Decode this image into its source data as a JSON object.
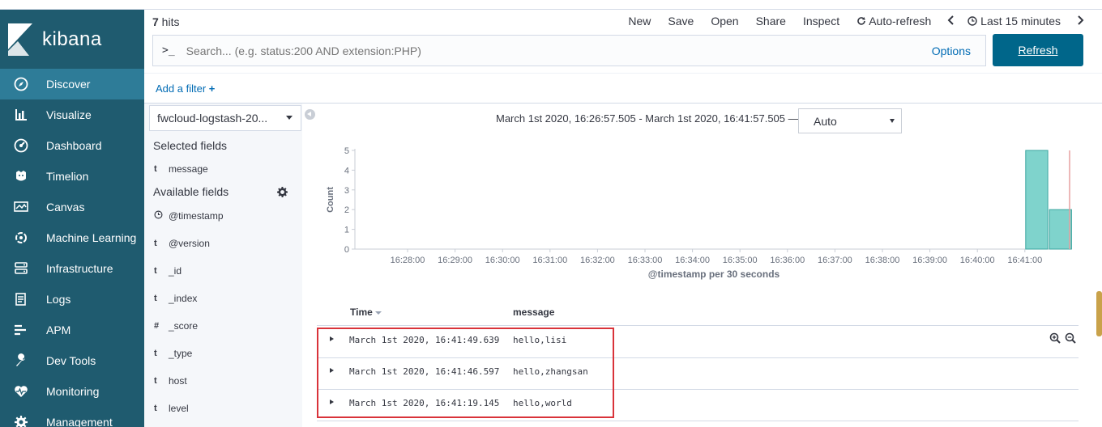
{
  "app": {
    "name": "kibana"
  },
  "colors": {
    "sidebar_bg": "#1f5b6f",
    "sidebar_active": "#2e7c98",
    "link": "#006bb4",
    "primary_button": "#00668a",
    "bar": "#7fd3cc",
    "bar_stroke": "#3aa69f",
    "now_line": "#e7a0a0",
    "highlight": "#d9333a"
  },
  "sidebar": {
    "items": [
      {
        "label": "Discover",
        "icon": "compass-icon",
        "active": true
      },
      {
        "label": "Visualize",
        "icon": "bar-chart-icon"
      },
      {
        "label": "Dashboard",
        "icon": "gauge-icon"
      },
      {
        "label": "Timelion",
        "icon": "timelion-icon"
      },
      {
        "label": "Canvas",
        "icon": "canvas-icon"
      },
      {
        "label": "Machine Learning",
        "icon": "ml-icon"
      },
      {
        "label": "Infrastructure",
        "icon": "server-icon"
      },
      {
        "label": "Logs",
        "icon": "logs-icon"
      },
      {
        "label": "APM",
        "icon": "apm-icon"
      },
      {
        "label": "Dev Tools",
        "icon": "wrench-icon"
      },
      {
        "label": "Monitoring",
        "icon": "heartbeat-icon"
      },
      {
        "label": "Management",
        "icon": "gear-icon"
      }
    ]
  },
  "topbar": {
    "hits_count": "7",
    "hits_label": " hits",
    "menu": [
      "New",
      "Save",
      "Open",
      "Share",
      "Inspect"
    ],
    "auto_refresh": "Auto-refresh",
    "time_label": "Last 15 minutes"
  },
  "query": {
    "prompt": ">_",
    "placeholder": "Search... (e.g. status:200 AND extension:PHP)",
    "options": "Options",
    "refresh": "Refresh"
  },
  "filters": {
    "add_filter": "Add a filter"
  },
  "fields": {
    "index_pattern": "fwcloud-logstash-20...",
    "selected_title": "Selected fields",
    "selected": [
      {
        "type": "t",
        "name": "message"
      }
    ],
    "available_title": "Available fields",
    "available": [
      {
        "type": "clock",
        "name": "@timestamp"
      },
      {
        "type": "t",
        "name": "@version"
      },
      {
        "type": "t",
        "name": "_id"
      },
      {
        "type": "t",
        "name": "_index"
      },
      {
        "type": "#",
        "name": "_score"
      },
      {
        "type": "t",
        "name": "_type"
      },
      {
        "type": "t",
        "name": "host"
      },
      {
        "type": "t",
        "name": "level"
      }
    ]
  },
  "histogram": {
    "date_range": "March 1st 2020, 16:26:57.505 - March 1st 2020, 16:41:57.505 —",
    "interval": "Auto"
  },
  "chart_data": {
    "type": "bar",
    "xlabel": "@timestamp per 30 seconds",
    "ylabel": "Count",
    "ylim": [
      0,
      5
    ],
    "yticks": [
      0,
      1,
      2,
      3,
      4,
      5
    ],
    "xticks": [
      "16:28:00",
      "16:29:00",
      "16:30:00",
      "16:31:00",
      "16:32:00",
      "16:33:00",
      "16:34:00",
      "16:35:00",
      "16:36:00",
      "16:37:00",
      "16:38:00",
      "16:39:00",
      "16:40:00",
      "16:41:00"
    ],
    "bars": [
      {
        "start": "16:41:00",
        "end": "16:41:30",
        "value": 5
      },
      {
        "start": "16:41:30",
        "end": "16:42:00",
        "value": 2
      }
    ],
    "grid": false
  },
  "table": {
    "columns": [
      "Time",
      "message"
    ],
    "rows": [
      {
        "time": "March 1st 2020, 16:41:49.639",
        "message": "hello,lisi"
      },
      {
        "time": "March 1st 2020, 16:41:46.597",
        "message": "hello,zhangsan"
      },
      {
        "time": "March 1st 2020, 16:41:19.145",
        "message": "hello,world"
      }
    ]
  }
}
